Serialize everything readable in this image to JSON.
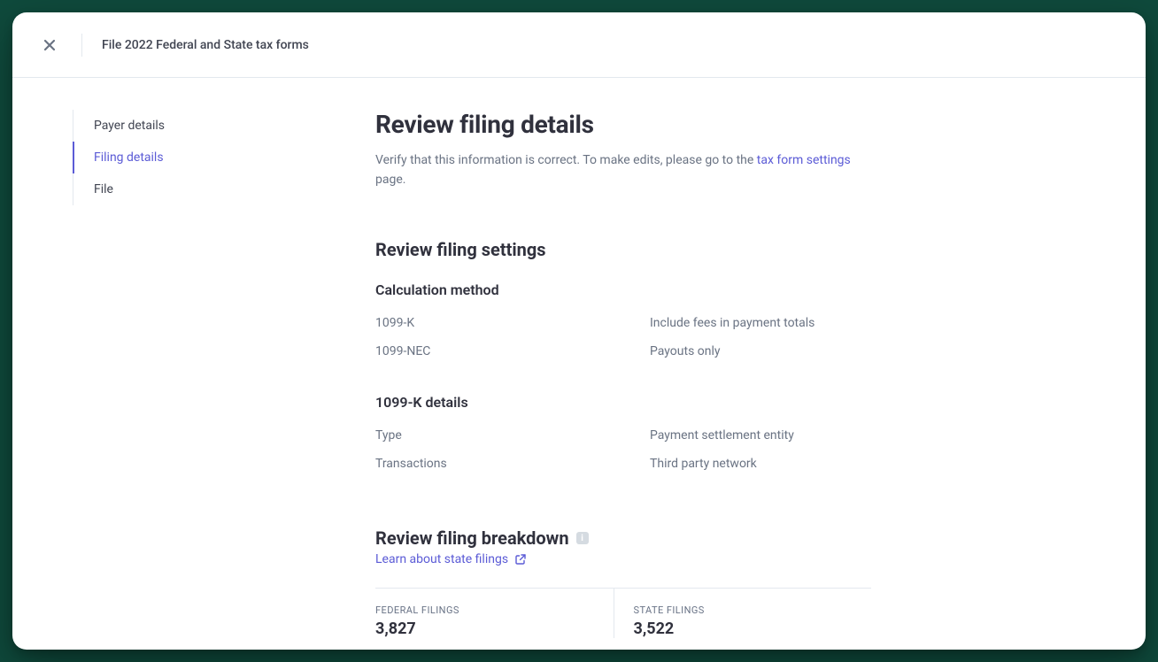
{
  "header": {
    "title": "File 2022 Federal and State tax forms"
  },
  "sidebar": {
    "items": [
      {
        "label": "Payer details",
        "active": false
      },
      {
        "label": "Filing details",
        "active": true
      },
      {
        "label": "File",
        "active": false
      }
    ]
  },
  "main": {
    "title": "Review filing details",
    "sub_prefix": "Verify that this information is correct. To make edits, please go to the ",
    "sub_link": "tax form settings",
    "sub_suffix": " page."
  },
  "settings_section": {
    "title": "Review filing settings",
    "calc_heading": "Calculation method",
    "calc_rows": [
      {
        "key": "1099-K",
        "val": "Include fees in payment totals"
      },
      {
        "key": "1099-NEC",
        "val": "Payouts only"
      }
    ],
    "details_heading": "1099-K details",
    "details_rows": [
      {
        "key": "Type",
        "val": "Payment settlement entity"
      },
      {
        "key": "Transactions",
        "val": "Third party network"
      }
    ]
  },
  "breakdown_section": {
    "title": "Review filing breakdown",
    "learn_link": "Learn about state filings",
    "stats": [
      {
        "label": "FEDERAL FILINGS",
        "value": "3,827"
      },
      {
        "label": "STATE FILINGS",
        "value": "3,522"
      }
    ]
  }
}
